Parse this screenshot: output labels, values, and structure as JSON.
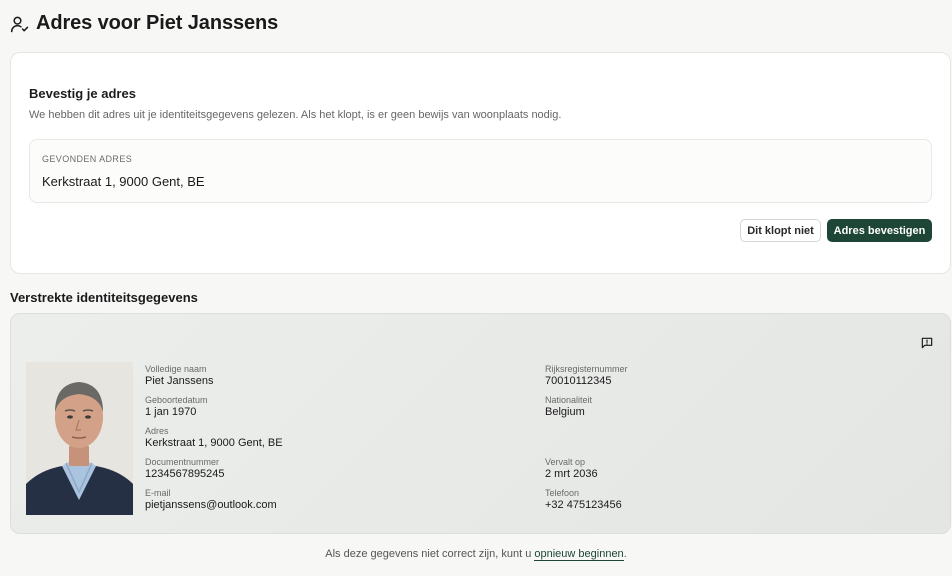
{
  "page": {
    "title": "Adres voor Piet Janssens",
    "icon": "user-check-icon"
  },
  "confirm": {
    "title": "Bevestig je adres",
    "subtitle": "We hebben dit adres uit je identiteitsgegevens gelezen. Als het klopt, is er geen bewijs van woonplaats nodig.",
    "found_label": "GEVONDEN ADRES",
    "found_value": "Kerkstraat 1, 9000 Gent, BE",
    "reject_label": "Dit klopt niet",
    "confirm_label": "Adres bevestigen"
  },
  "identity": {
    "section_title": "Verstrekte identiteitsgegevens",
    "feedback_icon": "message-alert-icon",
    "left_fields": [
      {
        "label": "Volledige naam",
        "value": "Piet Janssens"
      },
      {
        "label": "Geboortedatum",
        "value": "1 jan 1970"
      },
      {
        "label": "Adres",
        "value": "Kerkstraat 1, 9000 Gent, BE"
      },
      {
        "label": "Documentnummer",
        "value": "1234567895245"
      },
      {
        "label": "E-mail",
        "value": "pietjanssens@outlook.com"
      }
    ],
    "right_fields": [
      {
        "label": "Rijksregisternummer",
        "value": "70010112345"
      },
      {
        "label": "Nationaliteit",
        "value": "Belgium"
      },
      {
        "label": "Vervalt op",
        "value": "2 mrt 2036"
      },
      {
        "label": "Telefoon",
        "value": "+32 475123456"
      }
    ]
  },
  "footer": {
    "text": "Als deze gegevens niet correct zijn, kunt u ",
    "link": "opnieuw beginnen",
    "end": "."
  },
  "colors": {
    "accent": "#1d4637",
    "background": "#f7f7f6",
    "card": "#ffffff"
  }
}
